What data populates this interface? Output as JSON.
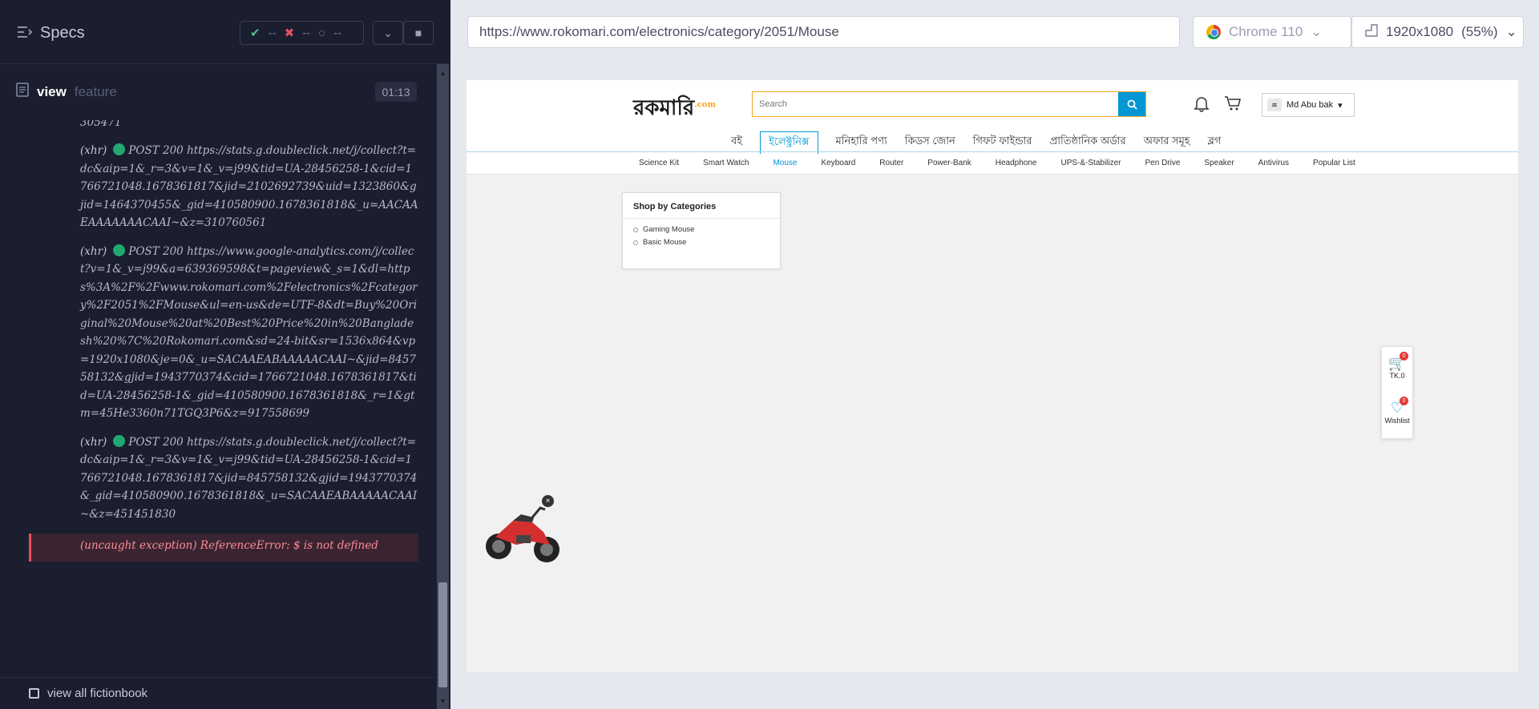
{
  "runner": {
    "specs_label": "Specs",
    "stats": {
      "passed": "--",
      "failed": "--",
      "pending": "--"
    },
    "spec_name": "view",
    "spec_suffix": "feature",
    "timer": "01:13",
    "bottom_checkbox_label": "view all fictionbook"
  },
  "log": {
    "cut_line": "305471",
    "entries": [
      {
        "tag": "(xhr)",
        "method_status": "POST 200",
        "url": "https://stats.g.doubleclick.net/j/collect?t=dc&aip=1&_r=3&v=1&_v=j99&tid=UA-28456258-1&cid=1766721048.1678361817&jid=2102692739&uid=1323860&gjid=1464370455&_gid=410580900.1678361818&_u=AACAAEAAAAAAACAAI~&z=310760561"
      },
      {
        "tag": "(xhr)",
        "method_status": "POST 200",
        "url": "https://www.google-analytics.com/j/collect?v=1&_v=j99&a=639369598&t=pageview&_s=1&dl=https%3A%2F%2Fwww.rokomari.com%2Felectronics%2Fcategory%2F2051%2FMouse&ul=en-us&de=UTF-8&dt=Buy%20Original%20Mouse%20at%20Best%20Price%20in%20Bangladesh%20%7C%20Rokomari.com&sd=24-bit&sr=1536x864&vp=1920x1080&je=0&_u=SACAAEABAAAAACAAI~&jid=845758132&gjid=1943770374&cid=1766721048.1678361817&tid=UA-28456258-1&_gid=410580900.1678361818&_r=1&gtm=45He3360n71TGQ3P6&z=917558699"
      },
      {
        "tag": "(xhr)",
        "method_status": "POST 200",
        "url": "https://stats.g.doubleclick.net/j/collect?t=dc&aip=1&_r=3&v=1&_v=j99&tid=UA-28456258-1&cid=1766721048.1678361817&jid=845758132&gjid=1943770374&_gid=410580900.1678361818&_u=SACAAEABAAAAACAAI~&z=451451830"
      }
    ],
    "error": "(uncaught exception)  ReferenceError: $ is not defined"
  },
  "browser": {
    "url": "https://www.rokomari.com/electronics/category/2051/Mouse",
    "browser_name": "Chrome 110",
    "viewport": "1920x1080",
    "zoom": "(55%)"
  },
  "site": {
    "logo": "রকমারি",
    "logo_suffix": ".com",
    "search_placeholder": "Search",
    "user_name": "Md Abu bak",
    "categories": [
      "বই",
      "ইলেক্ট্রনিক্স",
      "মনিহারি পণ্য",
      "কিডস জোন",
      "গিফট ফাইন্ডার",
      "প্রাতিষ্ঠানিক অর্ডার",
      "অফার সমূহ",
      "ব্লগ"
    ],
    "active_category_index": 1,
    "subcategories": [
      "Science Kit",
      "Smart Watch",
      "Mouse",
      "Keyboard",
      "Router",
      "Power-Bank",
      "Headphone",
      "UPS-&-Stabilizer",
      "Pen Drive",
      "Speaker",
      "Antivirus",
      "Popular List"
    ],
    "active_subcategory_index": 2,
    "shop_by_title": "Shop by Categories",
    "shop_by_items": [
      "Gaming Mouse",
      "Basic Mouse"
    ],
    "cart_badge": "0",
    "cart_total": "TK.0",
    "wishlist_badge": "0",
    "wishlist_label": "Wishlist"
  },
  "colors": {
    "accent": "#0397d3",
    "search_border": "#f5a623",
    "error": "#e94f5f",
    "success": "#1fa971"
  }
}
